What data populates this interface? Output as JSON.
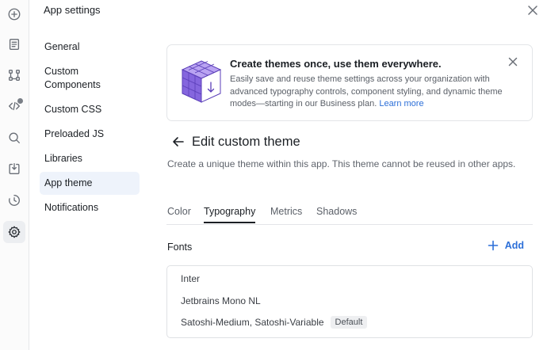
{
  "rail": {
    "icons": [
      "add-circle-icon",
      "page-icon",
      "nodes-icon",
      "code-icon",
      "search-icon",
      "import-icon",
      "history-icon",
      "settings-icon"
    ]
  },
  "header": {
    "title": "App settings"
  },
  "nav": {
    "items": [
      {
        "label": "General"
      },
      {
        "label": "Custom Components"
      },
      {
        "label": "Custom CSS"
      },
      {
        "label": "Preloaded JS"
      },
      {
        "label": "Libraries"
      },
      {
        "label": "App theme",
        "active": true
      },
      {
        "label": "Notifications"
      }
    ]
  },
  "banner": {
    "title": "Create themes once, use them everywhere.",
    "body": "Easily save and reuse theme settings across your organization with advanced typography controls, component styling, and dynamic theme modes—starting in our Business plan.",
    "link": "Learn more"
  },
  "page": {
    "title": "Edit custom theme",
    "description": "Create a unique theme within this app. This theme cannot be reused in other apps."
  },
  "tabs": [
    {
      "label": "Color"
    },
    {
      "label": "Typography",
      "active": true
    },
    {
      "label": "Metrics"
    },
    {
      "label": "Shadows"
    }
  ],
  "fonts": {
    "label": "Fonts",
    "add_label": "Add",
    "items": [
      {
        "name": "Inter"
      },
      {
        "name": "Jetbrains Mono NL"
      },
      {
        "name": "Satoshi-Medium, Satoshi-Variable",
        "badge": "Default"
      }
    ]
  },
  "colors": {
    "accent": "#2c6fd8",
    "cube": "#7b5ad8"
  }
}
